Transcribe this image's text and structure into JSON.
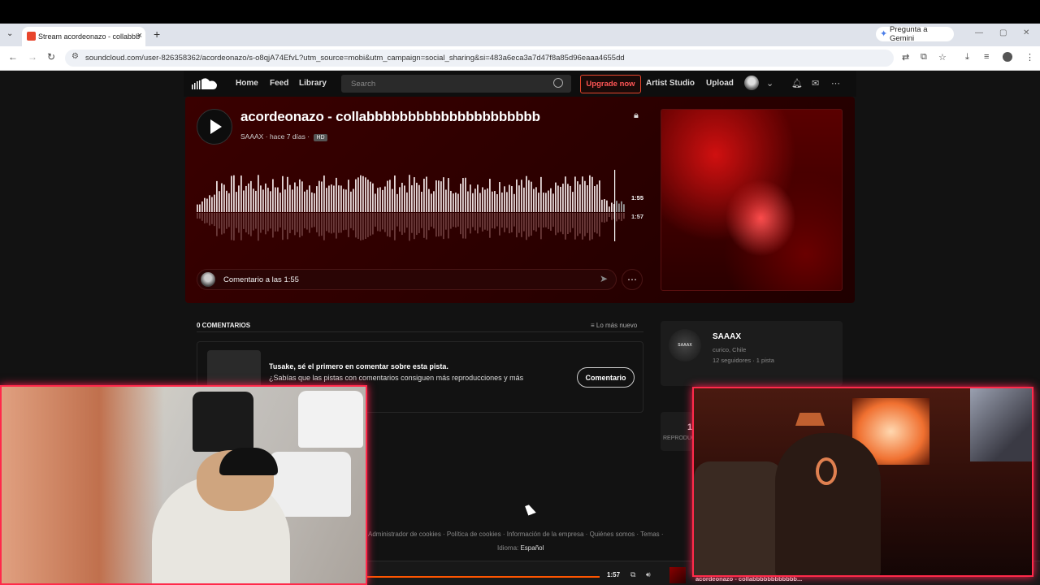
{
  "browser": {
    "tab_title": "Stream acordeonazo - collabbb",
    "tab_close": "×",
    "tab_dropdown": "⌄",
    "new_tab": "+",
    "gemini_label": "Pregunta a Gemini",
    "url": "soundcloud.com/user-826358362/acordeonazo/s-o8qjA74EfvL?utm_source=mobi&utm_campaign=social_sharing&si=483a6eca3a7d47f8a85d96eaaa4655dd"
  },
  "sc_header": {
    "nav": [
      "Home",
      "Feed",
      "Library"
    ],
    "search_placeholder": "Search",
    "upgrade": "Upgrade now",
    "artist_studio": "Artist Studio",
    "upload": "Upload"
  },
  "hero": {
    "title": "acordeonazo - collabbbbbbbbbbbbbbbbbbbbb",
    "artist": "SAAAX",
    "age": "hace 7 días",
    "hd": "HD",
    "time_current": "1:55",
    "time_total": "1:57",
    "comment_placeholder": "Comentario a las 1:55",
    "more": "⋯"
  },
  "comments": {
    "header": "0 COMENTARIOS",
    "sort": "Lo más nuevo",
    "first_title": "Tusake, sé el primero en comentar sobre esta pista.",
    "first_sub": "¿Sabías que las pistas con comentarios consiguen más reproducciones y más",
    "first_button": "Comentario"
  },
  "artist": {
    "avatar_text": "SAAAX",
    "name": "SAAAX",
    "location": "curico, Chile",
    "stats": "12 seguidores · 1 pista"
  },
  "stats": {
    "plays_num": "1",
    "plays_label": "REPRODUC"
  },
  "footer": {
    "links": "Administrador de cookies  ·  Política de cookies  ·  Información de la empresa  ·  Quiénes somos  ·  Temas  ·",
    "lang_label": "Idioma:",
    "lang_value": "Español"
  },
  "playbar": {
    "time": "1:57",
    "title": "acordeonazo - collabbbbbbbbbbbb..."
  },
  "colors": {
    "accent": "#ff5500",
    "stream_border": "#ff2a4a"
  }
}
